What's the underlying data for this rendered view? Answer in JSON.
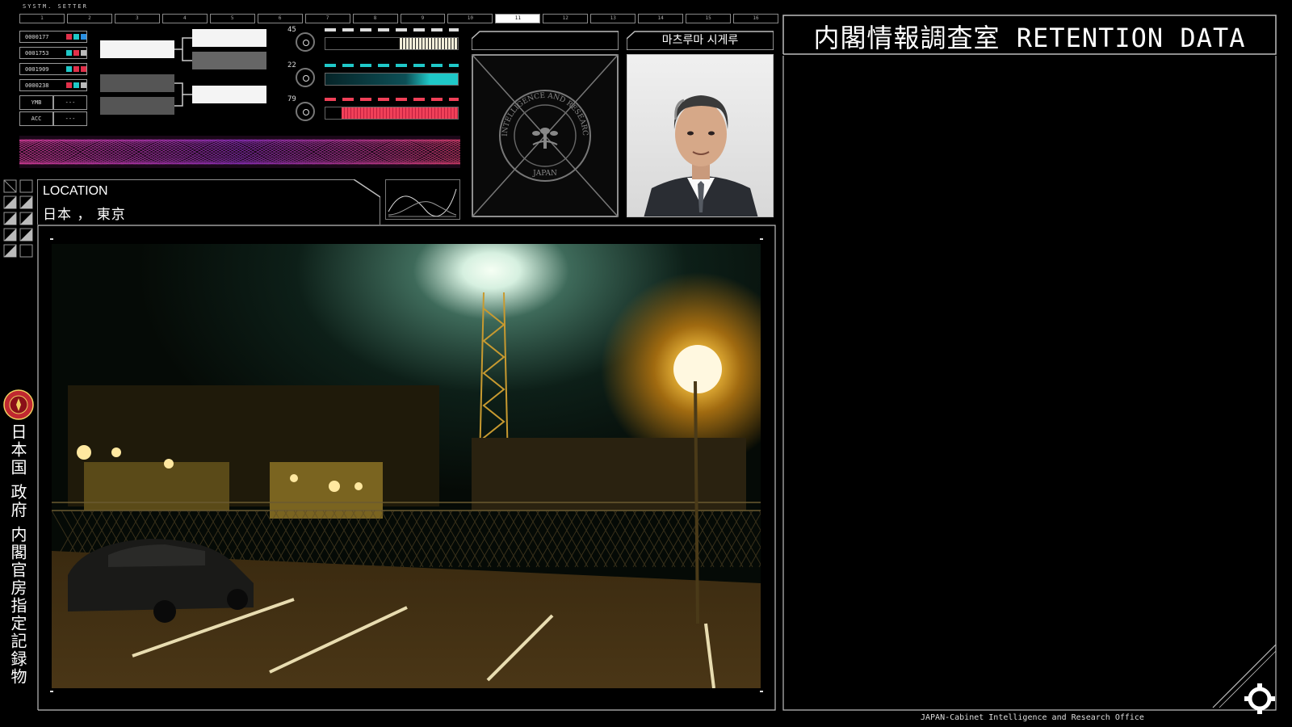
{
  "header": {
    "system_label": "SYSTM. SETTER",
    "tabs": [
      "1",
      "2",
      "3",
      "4",
      "5",
      "6",
      "7",
      "8",
      "9",
      "10",
      "11",
      "12",
      "13",
      "14",
      "15",
      "16"
    ],
    "active_tab_index": 10
  },
  "id_list": [
    {
      "id": "0000177",
      "colors": [
        "#e0304a",
        "#1fc8c8",
        "#2a8fe0"
      ]
    },
    {
      "id": "0001753",
      "colors": [
        "#1fc8c8",
        "#e0304a",
        "#bbbbbb"
      ]
    },
    {
      "id": "0001909",
      "colors": [
        "#1fc8c8",
        "#e0304a",
        "#e0304a"
      ]
    },
    {
      "id": "0000238",
      "colors": [
        "#e0304a",
        "#1fc8c8",
        "#bbbbbb"
      ]
    }
  ],
  "kv": [
    {
      "key": "YMB",
      "value": "---"
    },
    {
      "key": "ACC",
      "value": "---"
    }
  ],
  "dials": [
    {
      "value": "45",
      "color": "#f0ecd8"
    },
    {
      "value": "22",
      "color": "#1fc8c8"
    },
    {
      "value": "79",
      "color": "#f04058"
    }
  ],
  "location": {
    "label": "LOCATION",
    "value": "日本 ， 東京"
  },
  "emblem": {
    "seal_text": "CABINET INTELLIGENCE AND RESEARCH OFFICE",
    "country": "JAPAN"
  },
  "subject": {
    "name": "마츠루마 시게루"
  },
  "side_text": "日本国 政府 内閣官房指定記録物",
  "panel": {
    "title": "内閣情報調査室 RETENTION DATA",
    "footer": "JAPAN-Cabinet Intelligence and Research Office"
  },
  "colors": {
    "accent_red": "#e0304a",
    "accent_cyan": "#1fc8c8",
    "frame": "#bdbdbd",
    "background": "#000000"
  },
  "icons": [
    "seal-icon",
    "gear-icon"
  ]
}
